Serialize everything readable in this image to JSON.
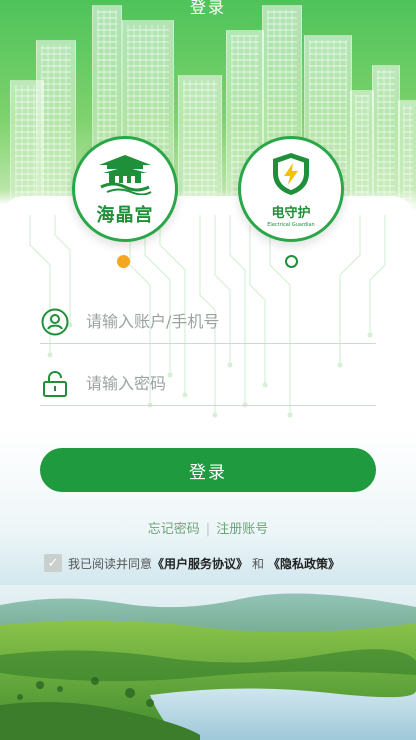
{
  "header": {
    "title": "登录"
  },
  "logos": {
    "left": {
      "name": "海晶宫",
      "icon": "palace-icon"
    },
    "right": {
      "name": "电守护",
      "subtitle": "Electrical Guardian",
      "icon": "shield-bolt-icon"
    }
  },
  "carousel": {
    "active_index": 0,
    "count": 2,
    "active_color": "#f5a623"
  },
  "form": {
    "account_placeholder": "请输入账户/手机号",
    "password_placeholder": "请输入密码",
    "account_icon": "user-icon",
    "password_icon": "lock-icon"
  },
  "login_button": {
    "label": "登录",
    "color": "#1f9a3f"
  },
  "links": {
    "forgot": "忘记密码",
    "separator": "|",
    "register": "注册账号"
  },
  "agreement": {
    "prefix": "我已阅读并同意",
    "service": "《用户服务协议》",
    "and": "和",
    "privacy": "《隐私政策》",
    "checked": true
  },
  "colors": {
    "brand_green": "#1f8f3a",
    "accent_orange": "#f5a623"
  }
}
